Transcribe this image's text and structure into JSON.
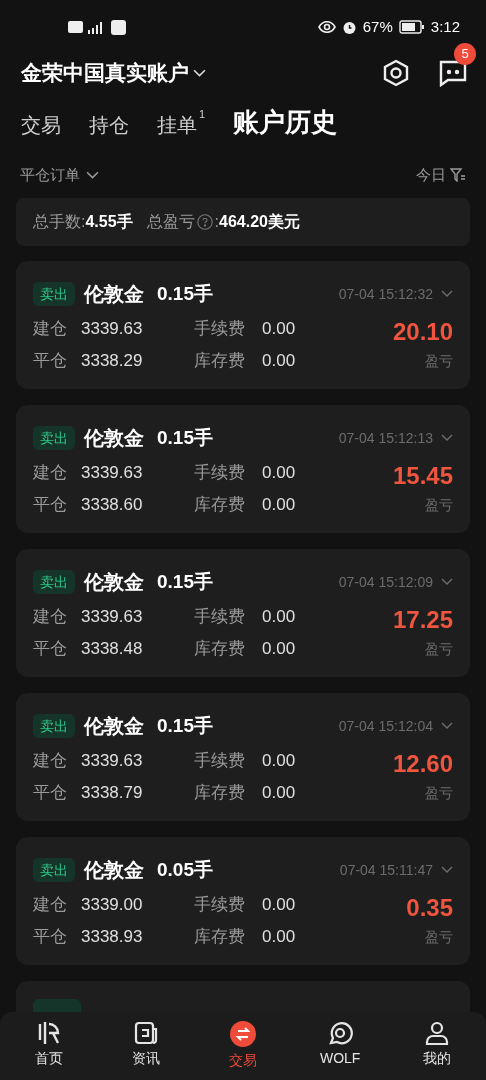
{
  "status_bar": {
    "battery": "67%",
    "time": "3:12"
  },
  "header": {
    "account": "金荣中国真实账户",
    "message_count": "5"
  },
  "tabs": [
    {
      "label": "交易",
      "selected": false
    },
    {
      "label": "持仓",
      "selected": false
    },
    {
      "label": "挂单",
      "selected": false,
      "badge": "1"
    },
    {
      "label": "账户历史",
      "selected": true
    }
  ],
  "filter": {
    "order_type": "平仓订单",
    "date": "今日"
  },
  "summary": {
    "lots_label": "总手数:",
    "lots": "4.55手",
    "pnl_label": "总盈亏",
    "pnl_colon": ":",
    "pnl": "464.20美元"
  },
  "orders": [
    {
      "side": "卖出",
      "symbol": "伦敦金",
      "lots": "0.15手",
      "time": "07-04 15:12:32",
      "open_label": "建仓",
      "open": "3339.63",
      "close_label": "平仓",
      "close": "3338.29",
      "fee_label": "手续费",
      "fee": "0.00",
      "swap_label": "库存费",
      "swap": "0.00",
      "pnl": "20.10",
      "pnl_label": "盈亏"
    },
    {
      "side": "卖出",
      "symbol": "伦敦金",
      "lots": "0.15手",
      "time": "07-04 15:12:13",
      "open_label": "建仓",
      "open": "3339.63",
      "close_label": "平仓",
      "close": "3338.60",
      "fee_label": "手续费",
      "fee": "0.00",
      "swap_label": "库存费",
      "swap": "0.00",
      "pnl": "15.45",
      "pnl_label": "盈亏"
    },
    {
      "side": "卖出",
      "symbol": "伦敦金",
      "lots": "0.15手",
      "time": "07-04 15:12:09",
      "open_label": "建仓",
      "open": "3339.63",
      "close_label": "平仓",
      "close": "3338.48",
      "fee_label": "手续费",
      "fee": "0.00",
      "swap_label": "库存费",
      "swap": "0.00",
      "pnl": "17.25",
      "pnl_label": "盈亏"
    },
    {
      "side": "卖出",
      "symbol": "伦敦金",
      "lots": "0.15手",
      "time": "07-04 15:12:04",
      "open_label": "建仓",
      "open": "3339.63",
      "close_label": "平仓",
      "close": "3338.79",
      "fee_label": "手续费",
      "fee": "0.00",
      "swap_label": "库存费",
      "swap": "0.00",
      "pnl": "12.60",
      "pnl_label": "盈亏"
    },
    {
      "side": "卖出",
      "symbol": "伦敦金",
      "lots": "0.05手",
      "time": "07-04 15:11:47",
      "open_label": "建仓",
      "open": "3339.00",
      "close_label": "平仓",
      "close": "3338.93",
      "fee_label": "手续费",
      "fee": "0.00",
      "swap_label": "库存费",
      "swap": "0.00",
      "pnl": "0.35",
      "pnl_label": "盈亏"
    }
  ],
  "bottom_nav": [
    {
      "label": "首页",
      "kind": "home",
      "selected": false
    },
    {
      "label": "资讯",
      "kind": "news",
      "selected": false
    },
    {
      "label": "交易",
      "kind": "trade",
      "selected": true
    },
    {
      "label": "WOLF",
      "kind": "chat",
      "selected": false
    },
    {
      "label": "我的",
      "kind": "profile",
      "selected": false
    }
  ]
}
